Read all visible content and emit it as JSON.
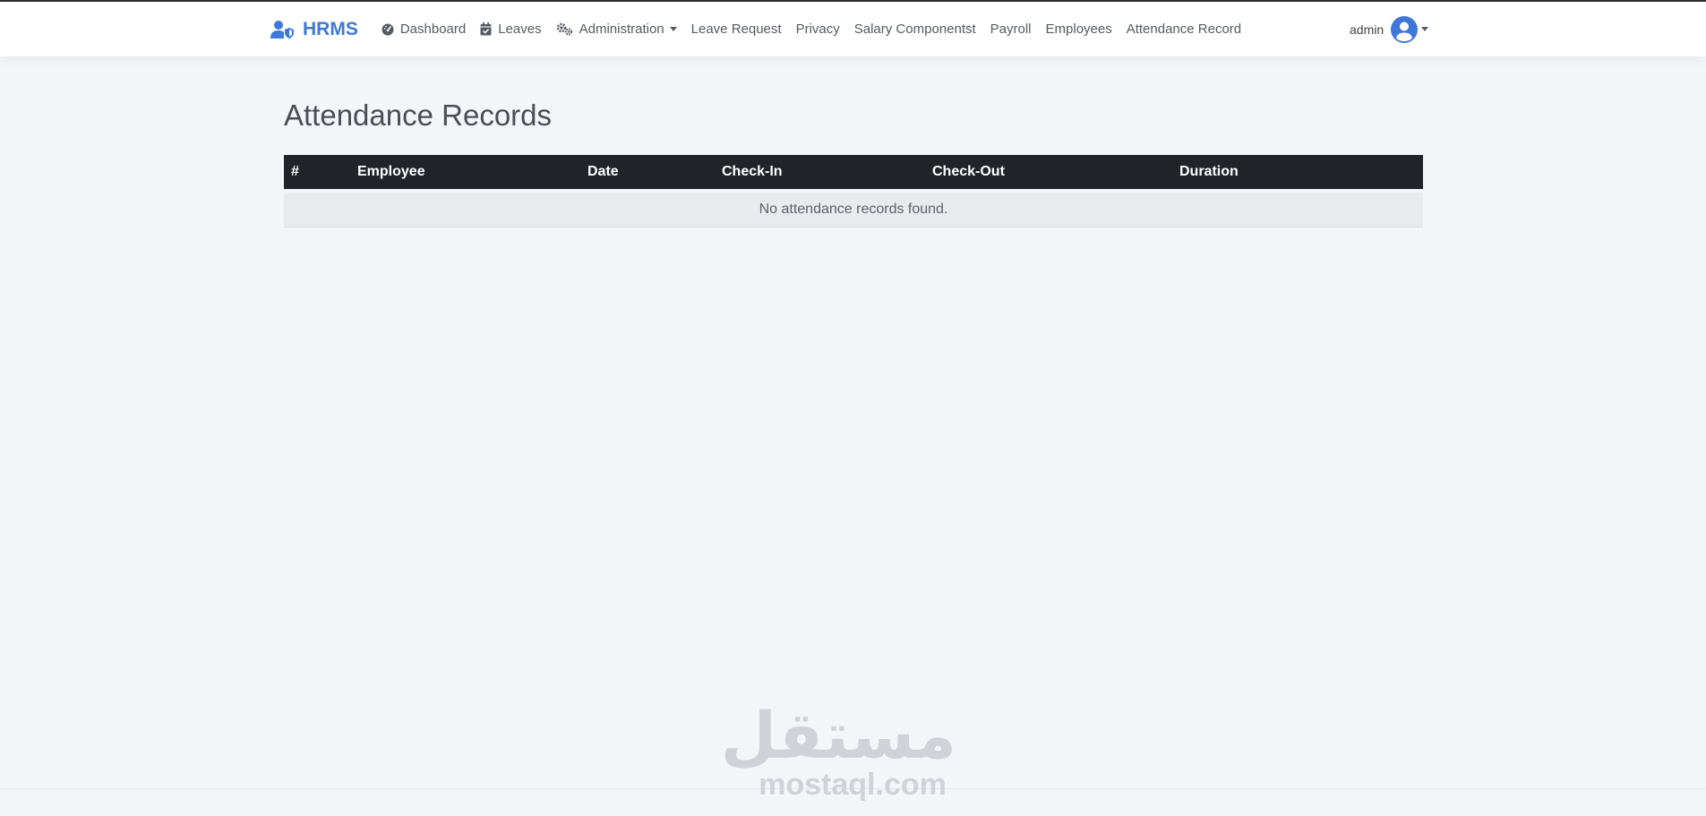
{
  "brand": {
    "name": "HRMS",
    "color": "#3f78d6"
  },
  "nav": {
    "dashboard": "Dashboard",
    "leaves": "Leaves",
    "administration": "Administration",
    "leave_request": "Leave Request",
    "privacy": "Privacy",
    "salary_components": "Salary Componentst",
    "payroll": "Payroll",
    "employees": "Employees",
    "attendance_record": "Attendance Record"
  },
  "user": {
    "name": "admin"
  },
  "page": {
    "title": "Attendance Records"
  },
  "table": {
    "columns": [
      "#",
      "Employee",
      "Date",
      "Check-In",
      "Check-Out",
      "Duration"
    ],
    "empty_message": "No attendance records found."
  },
  "watermark": {
    "arabic": "مستقل",
    "latin": "mostaql.com"
  },
  "icons": {
    "brand": "user-shield-icon",
    "dashboard": "gauge-icon",
    "leaves": "calendar-check-icon",
    "administration": "gears-icon",
    "avatar": "user-circle-icon"
  }
}
